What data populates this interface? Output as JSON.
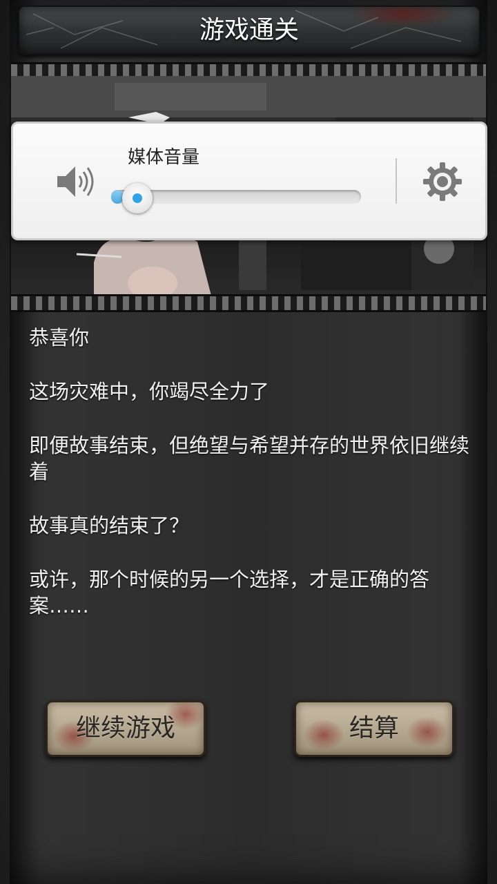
{
  "header": {
    "title": "游戏通关"
  },
  "volume_panel": {
    "label": "媒体音量",
    "level": 0.05,
    "speaker_icon": "speaker-icon",
    "settings_icon": "gear-icon",
    "accent": "#33a3e6"
  },
  "story": {
    "lines": [
      "恭喜你",
      "这场灾难中，你竭尽全力了",
      "即便故事结束，但绝望与希望并存的世界依旧继续着",
      "故事真的结束了？",
      "或许，那个时候的另一个选择，才是正确的答案……"
    ]
  },
  "buttons": {
    "continue_label": "继续游戏",
    "settle_label": "结算"
  }
}
